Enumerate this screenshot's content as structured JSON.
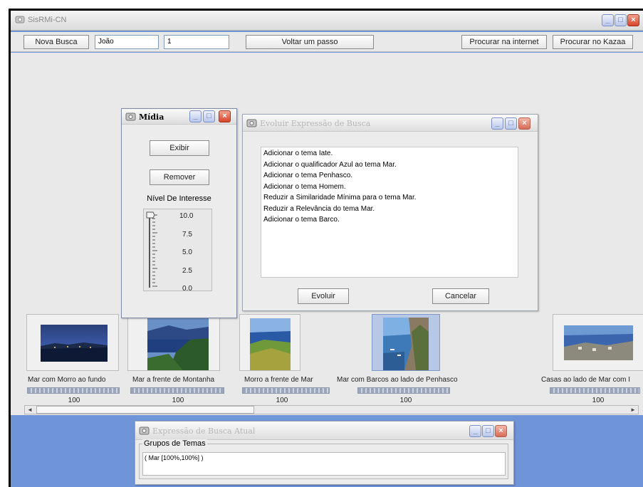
{
  "app": {
    "title": "SisRMi-CN"
  },
  "toolbar": {
    "new_search_label": "Nova Busca",
    "name_field_value": "João",
    "number_field_value": "1",
    "step_back_label": "Voltar um passo",
    "search_internet_label": "Procurar na internet",
    "search_kazaa_label": "Procurar no Kazaa"
  },
  "media_window": {
    "title": "Mídia",
    "show_label": "Exibir",
    "remove_label": "Remover",
    "interest_label": "Nível De Interesse",
    "interest_level": 10.0,
    "ticks": [
      "10.0",
      "7.5",
      "5.0",
      "2.5",
      "0.0"
    ]
  },
  "evolve_window": {
    "title": "Evoluir Expressão de Busca",
    "items": [
      "Adicionar o tema Iate.",
      "Adicionar o qualificador Azul ao tema Mar.",
      "Adicionar o tema Penhasco.",
      "Adicionar o tema Homem.",
      "Reduzir a Similaridade Mínima para o tema Mar.",
      "Reduzir a Relevância do tema Mar.",
      "Adicionar o tema Barco."
    ],
    "evolve_label": "Evoluir",
    "cancel_label": "Cancelar"
  },
  "results": [
    {
      "caption": "Mar com Morro ao fundo",
      "score": "100",
      "relevance": 1.0
    },
    {
      "caption": "Mar a frente de Montanha",
      "score": "100",
      "relevance": 1.0
    },
    {
      "caption": "Morro a frente de Mar",
      "score": "100",
      "relevance": 1.0
    },
    {
      "caption": "Mar com Barcos ao lado de Penhasco",
      "score": "100",
      "relevance": 1.0
    },
    {
      "caption": "Casas ao lado de Mar com I",
      "score": "100",
      "relevance": 1.0
    }
  ],
  "current_expression_window": {
    "title": "Expressão de Busca Atual",
    "group_label": "Grupos de Temas",
    "expression": "( Mar [100%,100%] )"
  },
  "colors": {
    "desktop_blue": "#6f94d8",
    "selected_thumb": "#b6c8e6",
    "close_red": "#d6442a"
  }
}
